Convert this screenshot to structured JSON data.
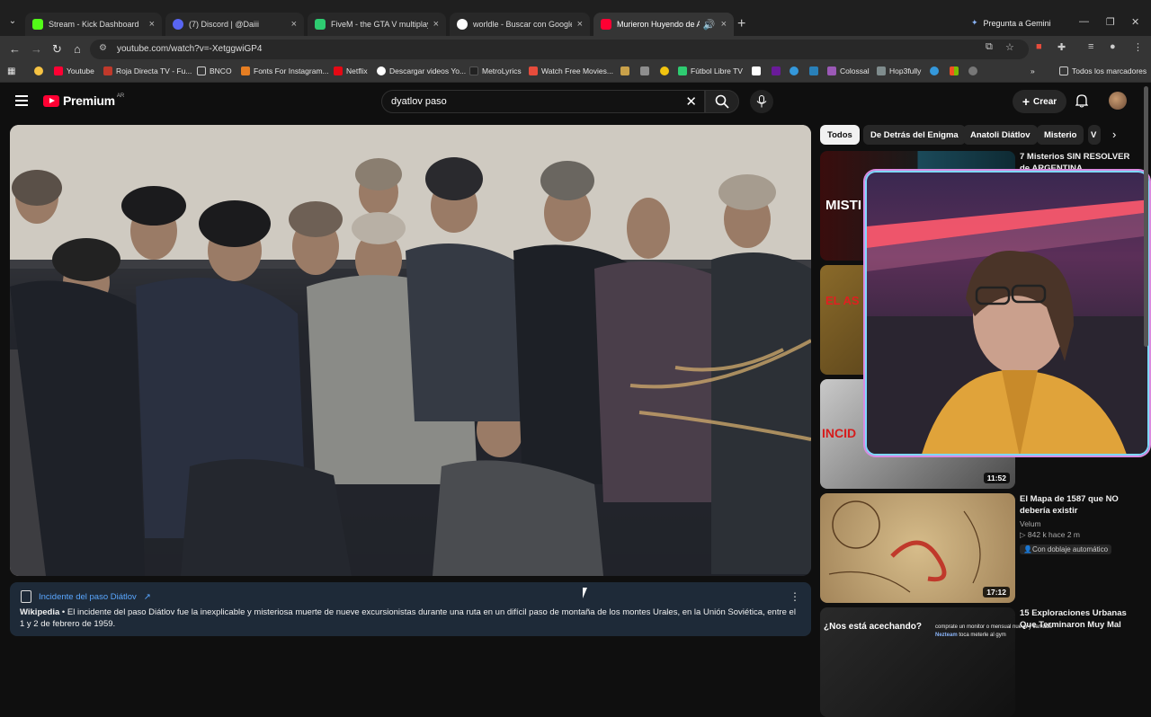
{
  "browser": {
    "tabs": [
      {
        "title": "Stream - Kick Dashboard",
        "color": "#53fc18"
      },
      {
        "title": "(7) Discord | @Daiii",
        "color": "#5865f2"
      },
      {
        "title": "FiveM - the GTA V multiplayer m",
        "color": "#2ecc71"
      },
      {
        "title": "worldle - Buscar con Google",
        "color": "#ffffff"
      },
      {
        "title": "Murieron Huyendo de Algo",
        "color": "#ff0033"
      }
    ],
    "gemini": "Pregunta a Gemini",
    "url": "youtube.com/watch?v=-XetggwiGP4",
    "bookmarks": [
      {
        "label": "",
        "color": "#f6c343"
      },
      {
        "label": "Youtube",
        "color": "#ff0033"
      },
      {
        "label": "Roja Directa TV - Fu...",
        "color": "#c0392b"
      },
      {
        "label": "BNCO",
        "color": "#888888"
      },
      {
        "label": "Fonts For Instagram...",
        "color": "#e67e22"
      },
      {
        "label": "Netflix",
        "color": "#e50914"
      },
      {
        "label": "Descargar videos Yo...",
        "color": "#ffffff"
      },
      {
        "label": "MetroLyrics",
        "color": "#222222"
      },
      {
        "label": "Watch Free Movies...",
        "color": "#e74c3c"
      },
      {
        "label": "Fútbol Libre TV",
        "color": "#2ecc71"
      },
      {
        "label": "Colossal",
        "color": "#9b59b6"
      },
      {
        "label": "Hop3fully",
        "color": "#7f8c8d"
      }
    ],
    "all_bookmarks": "Todos los marcadores"
  },
  "youtube": {
    "logo": "Premium",
    "country": "AR",
    "search_query": "dyatlov paso",
    "create": "Crear",
    "chips": [
      "Todos",
      "De Detrás del Enigma",
      "Anatoli Diátlov",
      "Misterio",
      "V"
    ],
    "wiki": {
      "title": "Incidente del paso Diátlov",
      "source": "Wikipedia",
      "text": " • El incidente del paso Diátlov fue la inexplicable y misteriosa muerte de nueve excursionistas durante una ruta en un difícil paso de montaña de los montes Urales, en la Unión Soviética, entre el 1 y 2 de febrero de 1959."
    },
    "side_videos": [
      {
        "title": "7 Misterios SIN RESOLVER de ARGENTINA",
        "channel": "",
        "stats": "",
        "badge": "",
        "duration": ""
      },
      {
        "title": "",
        "channel": "",
        "stats": "",
        "badge": "",
        "duration": ""
      },
      {
        "title": "",
        "channel": "",
        "stats": "",
        "badge": "",
        "duration": "11:52"
      },
      {
        "title": "El Mapa de 1587 que NO debería existir",
        "channel": "Velum",
        "stats": "▷ 842 k  hace 2 m",
        "badge": "Con doblaje automático",
        "duration": "17:12"
      },
      {
        "title": "15 Exploraciones Urbanas Que Terminaron Muy Mal",
        "channel": "",
        "stats": "",
        "badge": "",
        "duration": ""
      }
    ],
    "thumb_text": {
      "misti": "MISTI",
      "el_as": "EL AS",
      "incid": "INCID",
      "nos_esta": "¿Nos está acechando?"
    }
  },
  "stream_chat": [
    {
      "user": "",
      "msg": "comprate un monitor o mensual nueva y llamada"
    },
    {
      "user": "Nezteam",
      "msg": "toca meterle al gym"
    }
  ]
}
